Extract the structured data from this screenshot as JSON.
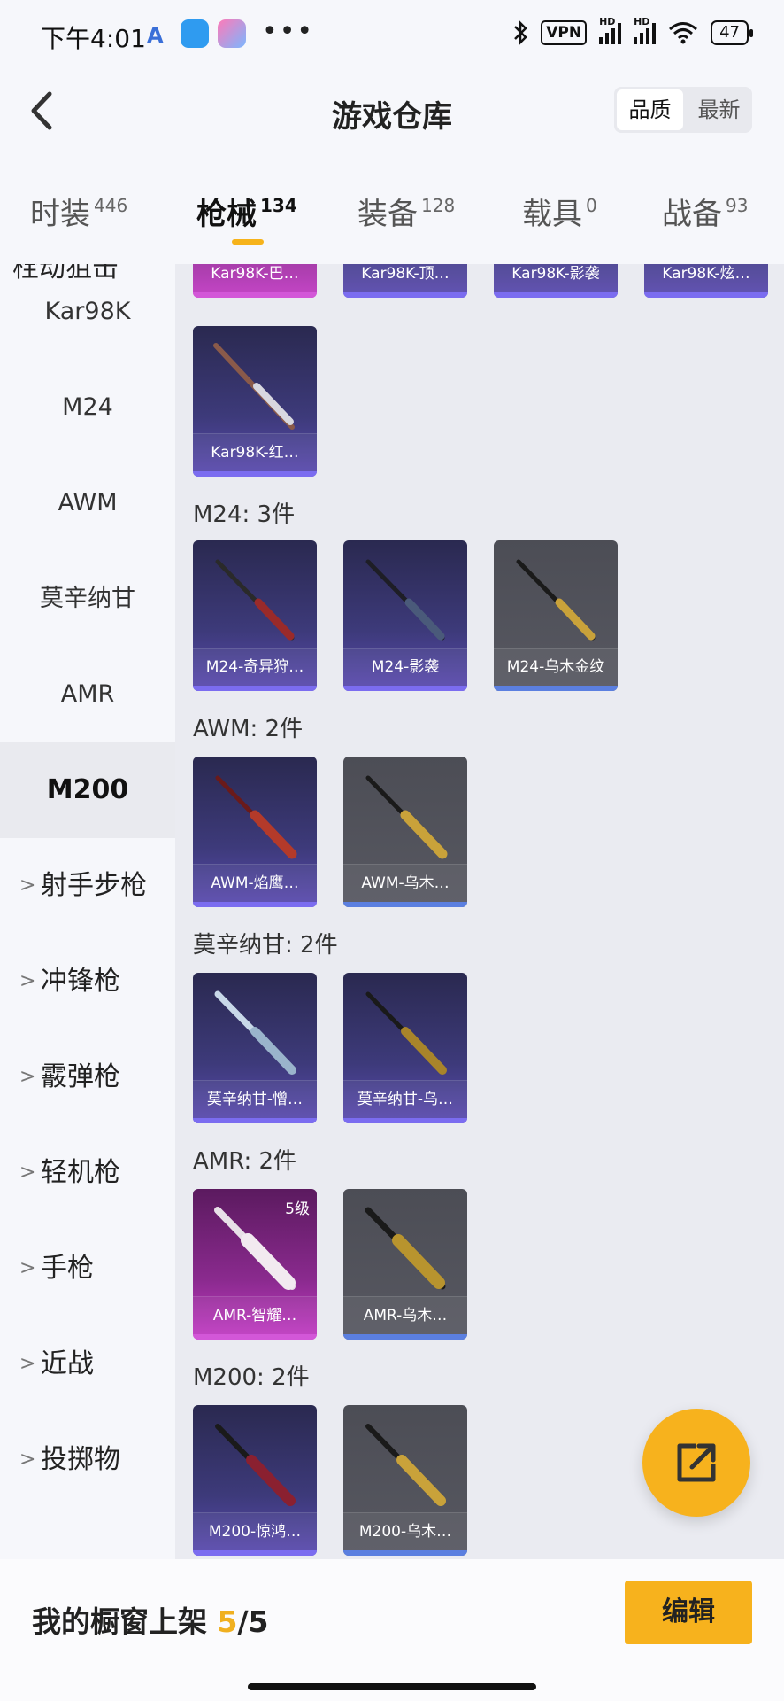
{
  "status": {
    "time": "下午4:01",
    "app_a": "A",
    "dots": "•••",
    "vpn": "VPN",
    "hd1": "HD",
    "hd2": "HD",
    "battery": "47"
  },
  "header": {
    "title": "游戏仓库",
    "sort_options": [
      "品质",
      "最新"
    ]
  },
  "tabs": [
    {
      "label": "时装",
      "count": "446"
    },
    {
      "label": "枪械",
      "count": "134"
    },
    {
      "label": "装备",
      "count": "128"
    },
    {
      "label": "载具",
      "count": "0"
    },
    {
      "label": "战备",
      "count": "93"
    }
  ],
  "sidebar": {
    "partial_group": "栓动狙击",
    "items": [
      "Kar98K",
      "M24",
      "AWM",
      "莫辛纳甘",
      "AMR",
      "M200"
    ],
    "groups": [
      "射手步枪",
      "冲锋枪",
      "霰弹枪",
      "轻机枪",
      "手枪",
      "近战",
      "投掷物"
    ]
  },
  "content": {
    "top_row": [
      "Kar98K-巴…",
      "Kar98K-顶…",
      "Kar98K-影袭",
      "Kar98K-炫…"
    ],
    "kar_single": "Kar98K-红…",
    "sections": [
      {
        "title": "M24: 3件",
        "items": [
          "M24-奇异狩…",
          "M24-影袭",
          "M24-乌木金纹"
        ]
      },
      {
        "title": "AWM: 2件",
        "items": [
          "AWM-焰鹰…",
          "AWM-乌木…"
        ]
      },
      {
        "title": "莫辛纳甘: 2件",
        "items": [
          "莫辛纳甘-憎…",
          "莫辛纳甘-乌…"
        ]
      },
      {
        "title": "AMR: 2件",
        "items": [
          "AMR-智耀…",
          "AMR-乌木…"
        ],
        "level": "5级"
      },
      {
        "title": "M200: 2件",
        "items": [
          "M200-惊鸿…",
          "M200-乌木…"
        ]
      }
    ]
  },
  "bottom": {
    "label": "我的橱窗上架 ",
    "count": "5",
    "total": "/5",
    "edit_label": "编辑"
  },
  "colors": {
    "accent": "#f7b21d",
    "purple_card": "#3d3a7a",
    "grey_card": "#575861",
    "pink_card": "#8a2a8e"
  }
}
